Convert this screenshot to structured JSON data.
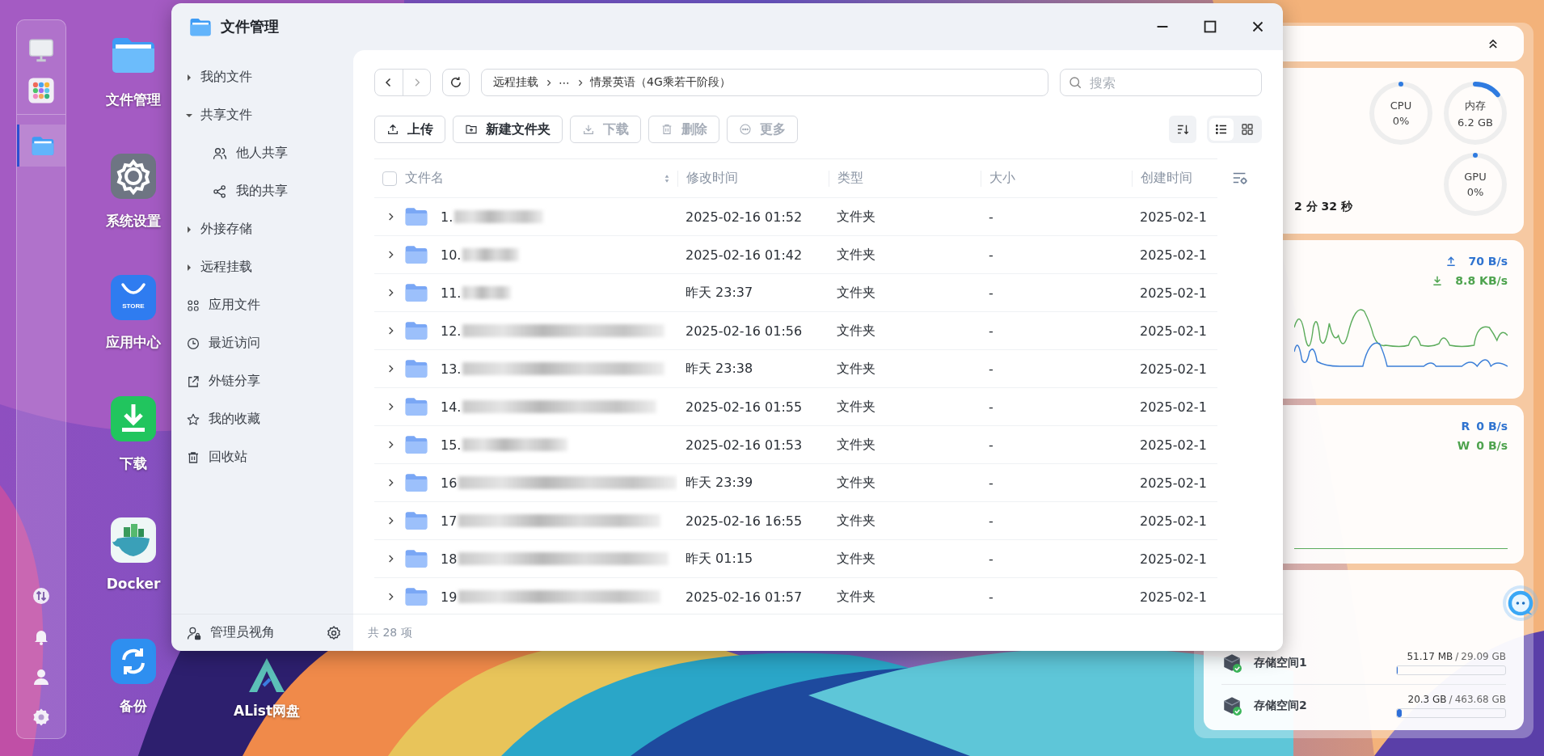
{
  "dock": {
    "open_apps": [
      {
        "active": true
      }
    ]
  },
  "desktop_icons": [
    {
      "label": "文件管理"
    },
    {
      "label": "系统设置"
    },
    {
      "label": "应用中心",
      "badge": "STORE"
    },
    {
      "label": "下载"
    },
    {
      "label": "Docker"
    },
    {
      "label": "备份"
    },
    {
      "label": "AList网盘"
    }
  ],
  "window": {
    "title": "文件管理"
  },
  "sidebar": {
    "items": [
      {
        "label": "我的文件",
        "kind": "group",
        "expanded": false
      },
      {
        "label": "共享文件",
        "kind": "group",
        "expanded": true,
        "children": [
          {
            "label": "他人共享"
          },
          {
            "label": "我的共享"
          }
        ]
      },
      {
        "label": "外接存储",
        "kind": "group",
        "expanded": false
      },
      {
        "label": "远程挂载",
        "kind": "group",
        "expanded": false
      },
      {
        "label": "应用文件",
        "kind": "link"
      },
      {
        "label": "最近访问",
        "kind": "link"
      },
      {
        "label": "外链分享",
        "kind": "link"
      },
      {
        "label": "我的收藏",
        "kind": "link"
      },
      {
        "label": "回收站",
        "kind": "link"
      }
    ],
    "footer": {
      "label": "管理员视角"
    }
  },
  "toolbar": {
    "breadcrumb": [
      "远程挂载",
      "⋯",
      "情景英语（4G乘若干阶段）"
    ],
    "search": {
      "placeholder": "搜索"
    }
  },
  "actions": [
    {
      "label": "上传",
      "disabled": false
    },
    {
      "label": "新建文件夹",
      "disabled": false
    },
    {
      "label": "下载",
      "disabled": true
    },
    {
      "label": "删除",
      "disabled": true
    },
    {
      "label": "更多",
      "disabled": true
    }
  ],
  "view_modes": [
    {
      "selected": true
    },
    {
      "selected": false
    }
  ],
  "table": {
    "select_all": {
      "checked": false
    },
    "columns": [
      "文件名",
      "修改时间",
      "类型",
      "大小",
      "创建时间"
    ],
    "rows": [
      {
        "name": "1.",
        "modified": "2025-02-16 01:52",
        "type": "文件夹",
        "size": "-",
        "created": "2025-02-1"
      },
      {
        "name": "10.",
        "modified": "2025-02-16 01:42",
        "type": "文件夹",
        "size": "-",
        "created": "2025-02-1"
      },
      {
        "name": "11.",
        "modified": "昨天 23:37",
        "type": "文件夹",
        "size": "-",
        "created": "2025-02-1"
      },
      {
        "name": "12.",
        "modified": "2025-02-16 01:56",
        "type": "文件夹",
        "size": "-",
        "created": "2025-02-1"
      },
      {
        "name": "13.",
        "modified": "昨天 23:38",
        "type": "文件夹",
        "size": "-",
        "created": "2025-02-1"
      },
      {
        "name": "14.",
        "modified": "2025-02-16 01:55",
        "type": "文件夹",
        "size": "-",
        "created": "2025-02-1"
      },
      {
        "name": "15.",
        "modified": "2025-02-16 01:53",
        "type": "文件夹",
        "size": "-",
        "created": "2025-02-1"
      },
      {
        "name": "16",
        "modified": "昨天 23:39",
        "type": "文件夹",
        "size": "-",
        "created": "2025-02-1"
      },
      {
        "name": "17",
        "modified": "2025-02-16 16:55",
        "type": "文件夹",
        "size": "-",
        "created": "2025-02-1"
      },
      {
        "name": "18",
        "modified": "昨天 01:15",
        "type": "文件夹",
        "size": "-",
        "created": "2025-02-1"
      },
      {
        "name": "19",
        "modified": "2025-02-16 01:57",
        "type": "文件夹",
        "size": "-",
        "created": "2025-02-1"
      }
    ]
  },
  "status_bar": "共 28 项",
  "widgets": {
    "uptime": "2 分 32 秒",
    "gauges": [
      {
        "label": "CPU",
        "value": "0%",
        "level": 0
      },
      {
        "label": "内存",
        "value": "6.2 GB",
        "level": 0.14
      },
      {
        "label": "GPU",
        "value": "0%",
        "level": 0
      }
    ],
    "network": {
      "upload": "70 B/s",
      "download": "8.8 KB/s"
    },
    "disk": {
      "read_label": "R",
      "read": "0 B/s",
      "write_label": "W",
      "write": "0 B/s"
    },
    "storage": [
      {
        "name": "存储空间1",
        "used": "51.17 MB",
        "separator": "/",
        "total": "29.09 GB",
        "level": 0.003
      },
      {
        "name": "存储空间2",
        "used": "20.3 GB",
        "separator": "/",
        "total": "463.68 GB",
        "level": 0.044
      }
    ]
  }
}
